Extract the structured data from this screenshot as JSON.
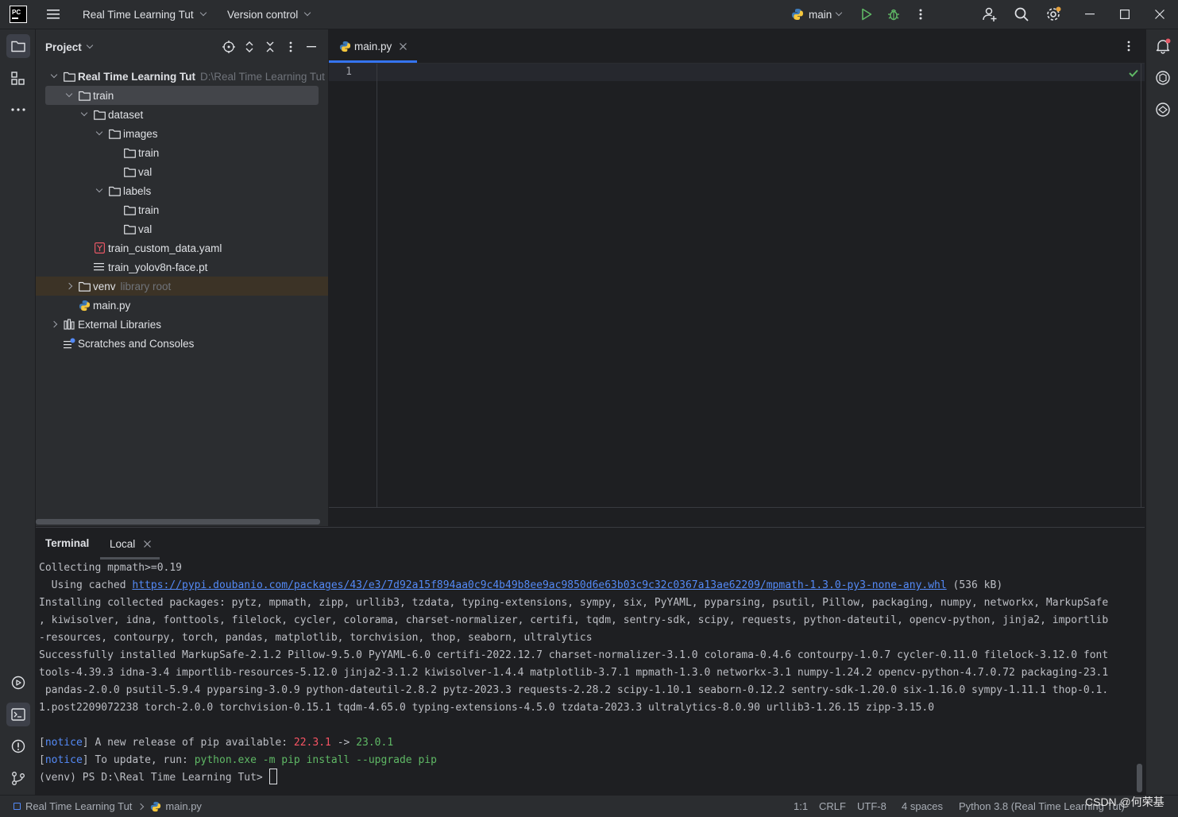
{
  "titlebar": {
    "project_name": "Real Time Learning Tut",
    "vcs": "Version control",
    "run_config": "main"
  },
  "project_panel": {
    "title": "Project",
    "tree": [
      {
        "label": "Real Time Learning Tut",
        "hint": "D:\\Real Time Learning Tut",
        "type": "folder",
        "bold": true
      },
      {
        "label": "train",
        "type": "folder"
      },
      {
        "label": "dataset",
        "type": "folder"
      },
      {
        "label": "images",
        "type": "folder"
      },
      {
        "label": "train",
        "type": "folder"
      },
      {
        "label": "val",
        "type": "folder"
      },
      {
        "label": "labels",
        "type": "folder"
      },
      {
        "label": "train",
        "type": "folder"
      },
      {
        "label": "val",
        "type": "folder"
      },
      {
        "label": "train_custom_data.yaml",
        "type": "yaml"
      },
      {
        "label": "train_yolov8n-face.pt",
        "type": "text"
      },
      {
        "label": "venv",
        "hint": "library root",
        "type": "folder"
      },
      {
        "label": "main.py",
        "type": "python"
      },
      {
        "label": "External Libraries",
        "type": "library"
      },
      {
        "label": "Scratches and Consoles",
        "type": "scratch"
      }
    ]
  },
  "editor": {
    "tab_label": "main.py",
    "line_numbers": [
      "1"
    ]
  },
  "terminal": {
    "title": "Terminal",
    "tab_label": "Local",
    "lines": {
      "l1": "Collecting mpmath>=0.19",
      "l2_prefix": "  Using cached ",
      "l2_link": "https://pypi.doubanio.com/packages/43/e3/7d92a15f894aa0c9c4b49b8ee9ac9850d6e63b03c9c32c0367a13ae62209/mpmath-1.3.0-py3-none-any.whl",
      "l2_suffix": " (536 kB)",
      "l3": "Installing collected packages: pytz, mpmath, zipp, urllib3, tzdata, typing-extensions, sympy, six, PyYAML, pyparsing, psutil, Pillow, packaging, numpy, networkx, MarkupSafe",
      "l4": ", kiwisolver, idna, fonttools, filelock, cycler, colorama, charset-normalizer, certifi, tqdm, sentry-sdk, scipy, requests, python-dateutil, opencv-python, jinja2, importlib",
      "l5": "-resources, contourpy, torch, pandas, matplotlib, torchvision, thop, seaborn, ultralytics",
      "l6": "Successfully installed MarkupSafe-2.1.2 Pillow-9.5.0 PyYAML-6.0 certifi-2022.12.7 charset-normalizer-3.1.0 colorama-0.4.6 contourpy-1.0.7 cycler-0.11.0 filelock-3.12.0 font",
      "l7": "tools-4.39.3 idna-3.4 importlib-resources-5.12.0 jinja2-3.1.2 kiwisolver-1.4.4 matplotlib-3.7.1 mpmath-1.3.0 networkx-3.1 numpy-1.24.2 opencv-python-4.7.0.72 packaging-23.1",
      "l8": " pandas-2.0.0 psutil-5.9.4 pyparsing-3.0.9 python-dateutil-2.8.2 pytz-2023.3 requests-2.28.2 scipy-1.10.1 seaborn-0.12.2 sentry-sdk-1.20.0 six-1.16.0 sympy-1.11.1 thop-0.1.",
      "l9": "1.post2209072238 torch-2.0.0 torchvision-0.15.1 tqdm-4.65.0 typing-extensions-4.5.0 tzdata-2023.3 ultralytics-8.0.90 urllib3-1.26.15 zipp-3.15.0",
      "notice_word": "notice",
      "n1_text": "A new release of pip available: ",
      "n1_old": "22.3.1",
      "n1_arrow": " -> ",
      "n1_new": "23.0.1",
      "n2_text": "To update, run: ",
      "n2_cmd": "python.exe -m pip install --upgrade pip",
      "prompt": "(venv) PS D:\\Real Time Learning Tut> "
    }
  },
  "statusbar": {
    "breadcrumb_project": "Real Time Learning Tut",
    "breadcrumb_file": "main.py",
    "position": "1:1",
    "line_sep": "CRLF",
    "encoding": "UTF-8",
    "indent": "4 spaces",
    "interpreter": "Python 3.8 (Real Time Learning Tut)",
    "watermark": "CSDN @何荣基"
  },
  "colors": {
    "accent": "#3574f0",
    "run_green": "#5fb865",
    "warn_orange": "#e08855"
  }
}
